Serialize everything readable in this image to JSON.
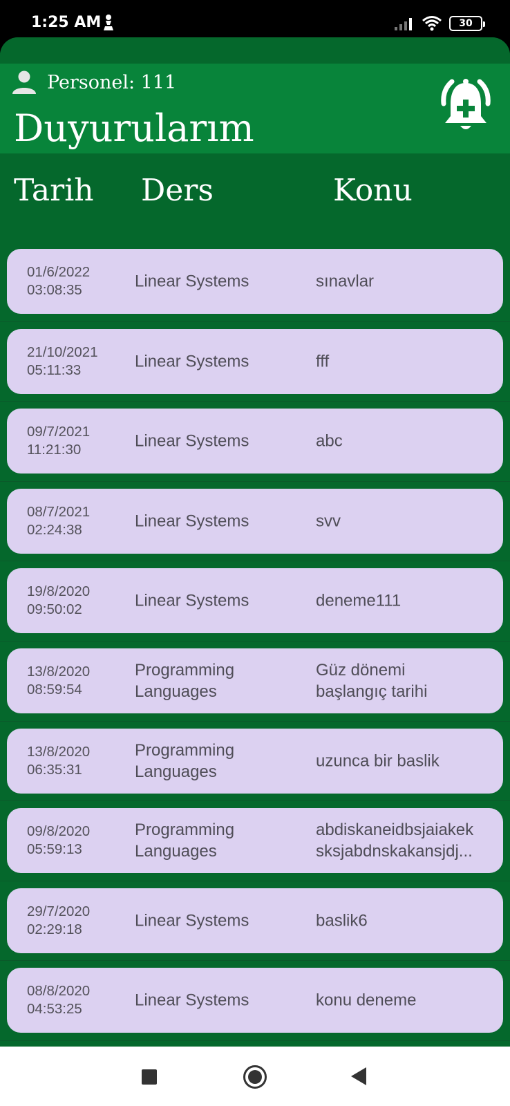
{
  "status_bar": {
    "time": "1:25 AM",
    "battery": "30",
    "icons": [
      "chess-pawn-icon",
      "signal-icon",
      "wifi-icon",
      "battery-icon"
    ]
  },
  "header": {
    "personel": "Personel: 111",
    "title": "Duyurularım",
    "add_button_icon": "bell-plus-icon"
  },
  "columns": {
    "tarih": "Tarih",
    "ders": "Ders",
    "konu": "Konu"
  },
  "announcements": [
    {
      "date": "01/6/2022",
      "time": "03:08:35",
      "ders": [
        "Linear Systems"
      ],
      "konu": [
        "sınavlar"
      ]
    },
    {
      "date": "21/10/2021",
      "time": "05:11:33",
      "ders": [
        "Linear Systems"
      ],
      "konu": [
        "fff"
      ]
    },
    {
      "date": "09/7/2021",
      "time": "11:21:30",
      "ders": [
        "Linear Systems"
      ],
      "konu": [
        "abc"
      ]
    },
    {
      "date": "08/7/2021",
      "time": "02:24:38",
      "ders": [
        "Linear Systems"
      ],
      "konu": [
        "svv"
      ]
    },
    {
      "date": "19/8/2020",
      "time": "09:50:02",
      "ders": [
        "Linear Systems"
      ],
      "konu": [
        "deneme111"
      ]
    },
    {
      "date": "13/8/2020",
      "time": "08:59:54",
      "ders": [
        "Programming",
        "Languages"
      ],
      "konu": [
        "Güz dönemi",
        "başlangıç tarihi"
      ]
    },
    {
      "date": "13/8/2020",
      "time": "06:35:31",
      "ders": [
        "Programming",
        "Languages"
      ],
      "konu": [
        "uzunca bir baslik"
      ]
    },
    {
      "date": "09/8/2020",
      "time": "05:59:13",
      "ders": [
        "Programming",
        "Languages"
      ],
      "konu": [
        "abdiskaneidbsjaiakek",
        "sksjabdnskakansjdj..."
      ]
    },
    {
      "date": "29/7/2020",
      "time": "02:29:18",
      "ders": [
        "Linear Systems"
      ],
      "konu": [
        "baslik6"
      ]
    },
    {
      "date": "08/8/2020",
      "time": "04:53:25",
      "ders": [
        "Linear Systems"
      ],
      "konu": [
        "konu deneme"
      ]
    }
  ],
  "nav_bar": {
    "icons": [
      "recents-square-icon",
      "home-circle-icon",
      "back-triangle-icon"
    ]
  },
  "colors": {
    "header_green": "#08843a",
    "background_green": "#05682c",
    "card_lavender": "#dcd1f1",
    "card_text": "#4f4d57"
  }
}
